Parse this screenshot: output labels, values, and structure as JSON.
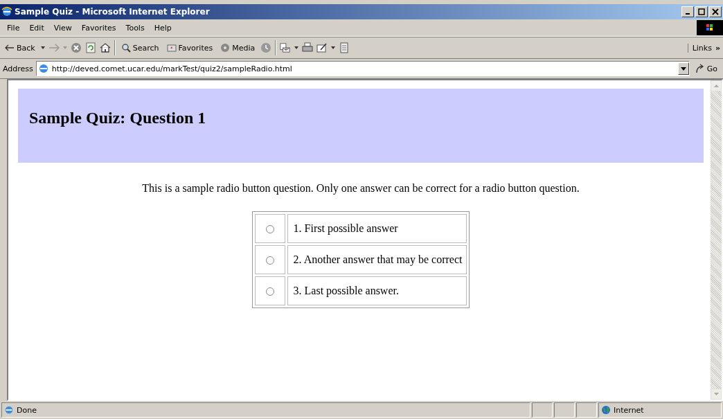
{
  "window": {
    "title": "Sample Quiz - Microsoft Internet Explorer"
  },
  "menu": [
    "File",
    "Edit",
    "View",
    "Favorites",
    "Tools",
    "Help"
  ],
  "toolbar": {
    "back": "Back",
    "search": "Search",
    "favorites": "Favorites",
    "media": "Media",
    "links": "Links",
    "links_more": "»"
  },
  "address": {
    "label": "Address",
    "url": "http://deved.comet.ucar.edu/markTest/quiz2/sampleRadio.html",
    "go": "Go"
  },
  "page": {
    "heading": "Sample Quiz: Question 1",
    "instructions": "This is a sample radio button question. Only one answer can be correct for a radio button question.",
    "answers": [
      {
        "text": "1. First possible answer",
        "selected": false
      },
      {
        "text": "2. Another answer that may be correct",
        "selected": false
      },
      {
        "text": "3. Last possible answer.",
        "selected": false
      }
    ]
  },
  "status_bar": {
    "text": "Done",
    "zone": "Internet"
  }
}
